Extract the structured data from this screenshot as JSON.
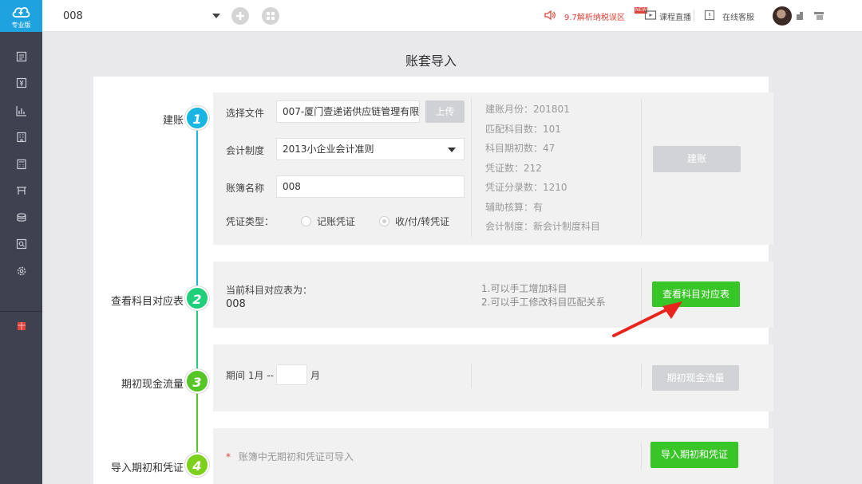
{
  "sidebar": {
    "logo_label": "专业版",
    "items": [
      "menu-1",
      "menu-2",
      "menu-3",
      "menu-4",
      "menu-5",
      "menu-6",
      "menu-7",
      "menu-8",
      "menu-9"
    ]
  },
  "topbar": {
    "company": "008",
    "promo_link": "9.7解析纳税误区",
    "course_link": "课程直播",
    "new_badge": "NEW",
    "service_link": "在线客服"
  },
  "page": {
    "title": "账套导入"
  },
  "steps": [
    {
      "num": "1",
      "label": "建账",
      "color": "#1ab5e2"
    },
    {
      "num": "2",
      "label": "查看科目对应表",
      "color": "#1fcf7a"
    },
    {
      "num": "3",
      "label": "期初现金流量",
      "color": "#56c626"
    },
    {
      "num": "4",
      "label": "导入期初和凭证",
      "color": "#7dd11c"
    }
  ],
  "step1": {
    "file_label": "选择文件",
    "file_value": "007-厦门壹递诺供应链管理有限",
    "upload_btn": "上传",
    "system_label": "会计制度",
    "system_value": "2013小企业会计准则",
    "book_label": "账簿名称",
    "book_value": "008",
    "voucher_label": "凭证类型：",
    "voucher_opt1": "记账凭证",
    "voucher_opt2": "收/付/转凭证",
    "info": [
      "建账月份：201801",
      "匹配科目数：101",
      "科目期初数：47",
      "凭证数：212",
      "凭证分录数：1210",
      "辅助核算：有",
      "会计制度：新会计制度科目"
    ],
    "action_btn": "建账"
  },
  "step2": {
    "current_label": "当前科目对应表为：",
    "current_value": "008",
    "note1": "1.可以手工增加科目",
    "note2": "2.可以手工修改科目匹配关系",
    "action_btn": "查看科目对应表"
  },
  "step3": {
    "period_label": "期间 1月 --",
    "month_suffix": "月",
    "month_value": "",
    "action_btn": "期初现金流量"
  },
  "step4": {
    "star": "*",
    "note": "账簿中无期初和凭证可导入",
    "action_btn": "导入期初和凭证"
  },
  "colors": {
    "green": "#38c527",
    "blue": "#1ea3e0",
    "red": "#e0443a",
    "sidebar": "#3e4250"
  }
}
